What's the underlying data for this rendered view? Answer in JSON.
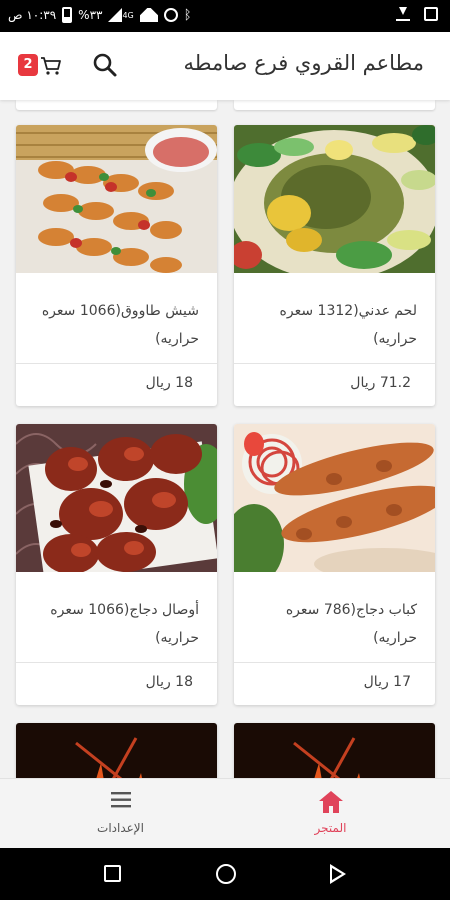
{
  "status_bar": {
    "time": "١٠:٣٩ ص",
    "battery": "%٣٣",
    "network": "4G"
  },
  "header": {
    "title": "مطاعم القروي فرع صامطه",
    "cart_count": "2",
    "accent": "#e8383f"
  },
  "products": [
    {
      "name": "لحم عدني(1312 سعره حراريه)",
      "price": "71.2 ريال",
      "image": "lamb-dish-image"
    },
    {
      "name": "شيش طاووق(1066 سعره حراريه)",
      "price": "18 ريال",
      "image": "shish-tawook-image"
    },
    {
      "name": "كباب دجاج(786 سعره حراريه)",
      "price": "17 ريال",
      "image": "chicken-kebab-image"
    },
    {
      "name": "أوصال دجاج(1066 سعره حراريه)",
      "price": "18 ريال",
      "image": "chicken-pieces-image"
    }
  ],
  "bottom_nav": {
    "store_label": "المتجر",
    "settings_label": "الإعدادات",
    "active_color": "#e0435a"
  }
}
